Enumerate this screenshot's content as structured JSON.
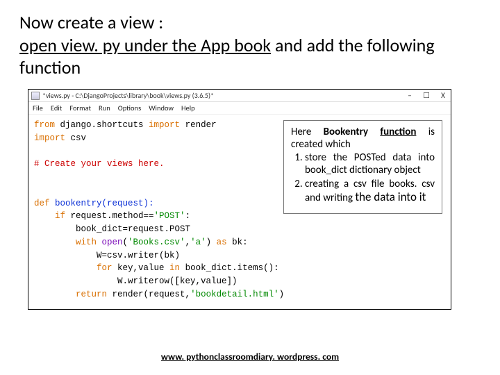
{
  "heading": {
    "line1": "Now create a view :",
    "line2a": "open view. py under the App book",
    "line2b": " and add the following function"
  },
  "editor": {
    "titlebar_text": "*views.py - C:\\DjangoProjects\\library\\book\\views.py (3.6.5)*",
    "win": {
      "min": "–",
      "max": "☐",
      "close": "X"
    },
    "menu": [
      "File",
      "Edit",
      "Format",
      "Run",
      "Options",
      "Window",
      "Help"
    ],
    "code": {
      "l1a": "from",
      "l1b": " django.shortcuts ",
      "l1c": "import",
      "l1d": " render",
      "l2a": "import",
      "l2b": " csv",
      "l4": "# Create your views here.",
      "l7a": "def",
      "l7b": " bookentry(request):",
      "l8a": "    if",
      "l8b": " request.method==",
      "l8c": "'POST'",
      "l8d": ":",
      "l9": "        book_dict=request.POST",
      "l10a": "        with",
      "l10b": " open",
      "l10c": "(",
      "l10d": "'Books.csv'",
      "l10e": ",",
      "l10f": "'a'",
      "l10g": ") ",
      "l10h": "as",
      "l10i": " bk:",
      "l11": "            W=csv.writer(bk)",
      "l12a": "            for",
      "l12b": " key,value ",
      "l12c": "in",
      "l12d": " book_dict.items():",
      "l13": "                W.writerow([key,value])",
      "l14a": "        return",
      "l14b": " render(request,",
      "l14c": "'bookdetail.html'",
      "l14d": ")"
    }
  },
  "callout": {
    "lead_a": "Here ",
    "lead_b": "Bookentry ",
    "lead_c": "function",
    "lead_d": "  is created which",
    "item1": "store the POSTed data into book_dict dictionary object",
    "item2a": " creating a csv file books. csv and writing ",
    "item2b": "the",
    "item2c": " data into it"
  },
  "footer": {
    "link": "www. pythonclassroomdiary. wordpress. com"
  }
}
